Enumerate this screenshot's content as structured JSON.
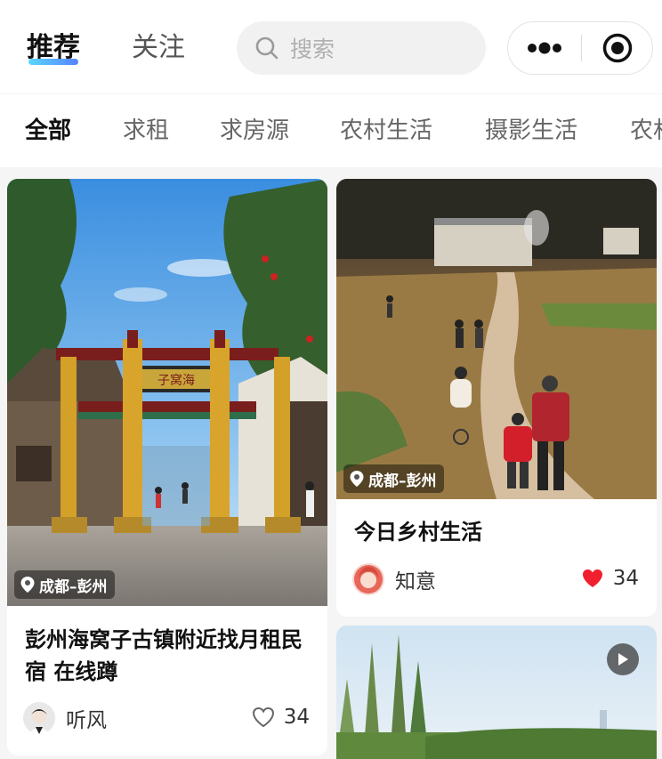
{
  "header": {
    "tabs": [
      {
        "label": "推荐",
        "active": true
      },
      {
        "label": "关注",
        "active": false
      }
    ],
    "search": {
      "placeholder": "搜索"
    },
    "capsule": {
      "more_icon": "more-dots-icon",
      "target_icon": "target-circle-icon"
    }
  },
  "categories": [
    {
      "label": "全部",
      "active": true
    },
    {
      "label": "求租",
      "active": false
    },
    {
      "label": "求房源",
      "active": false
    },
    {
      "label": "农村生活",
      "active": false
    },
    {
      "label": "摄影生活",
      "active": false
    },
    {
      "label": "农村",
      "active": false
    }
  ],
  "cards": [
    {
      "location": "成都–彭州",
      "title": "彭州海窝子古镇附近找月租民宿 在线蹲",
      "author": "听风",
      "likes": "34",
      "liked": false,
      "sign_text": "子窝海"
    },
    {
      "location": "成都–彭州",
      "title": "今日乡村生活",
      "author": "知意",
      "likes": "34",
      "liked": true
    },
    {
      "has_video": true,
      "video_icon": "play-icon"
    }
  ],
  "colors": {
    "liked_heart": "#f0202e",
    "tab_underline": "#3a8dff",
    "page_bg": "#f5f5f5"
  }
}
